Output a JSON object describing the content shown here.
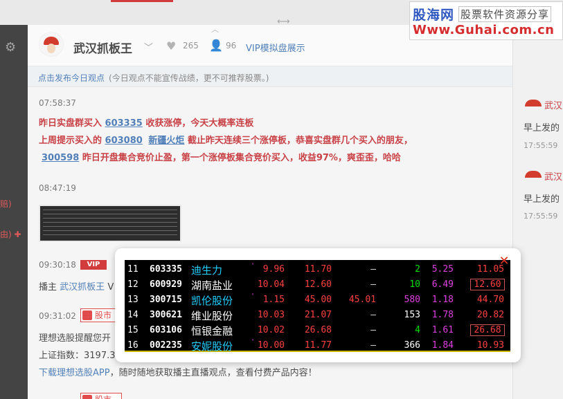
{
  "header": {
    "host_name": "武汉抓板王",
    "likes": "265",
    "fans": "96",
    "vip_link": "VIP模拟盘展示"
  },
  "notice": {
    "link": "点击发布今日观点",
    "hint": "(今日观点不能宣传战绩，更不可推荐股票。)"
  },
  "feed": {
    "post1": {
      "time": "07:58:37",
      "l1_a": "昨日实盘群买入",
      "l1_code": "603335",
      "l1_b": "收获涨停，今天大概率连板",
      "l2_a": "上周提示买入的",
      "l2_code": "603080",
      "l2_sector": "新疆火炬",
      "l2_b": "截止昨天连续三个涨停板，恭喜实盘群几个买入的朋友，",
      "l3_code": "300598",
      "l3_b": "昨日开盘集合竞价止盈，第一个涨停板集合竞价买入，收益97%，爽歪歪，哈哈"
    },
    "post2_time": "08:47:19",
    "post3": {
      "time": "09:30:18",
      "vip": "VIP",
      "prefix": "播主",
      "host": "武汉抓板王",
      "suffix": "V"
    },
    "post4": {
      "time": "09:31:02",
      "tag": "股市",
      "line1": "理想选股提醒您开",
      "line2": "上证指数：3197.3"
    },
    "download": {
      "link": "下载理想选股APP",
      "rest": "，随时随地获取播主直播观点，查看付费产品内容！"
    },
    "post5_tag": "股市"
  },
  "left_tabs": {
    "a": "赔)",
    "b": "由) ✚"
  },
  "right_column": [
    {
      "name": "武汉",
      "text": "早上发的",
      "time": "17:55:59"
    },
    {
      "name": "武汉",
      "text": "早上发的",
      "time": "17:55:59"
    }
  ],
  "watermark": {
    "cn": "股海网",
    "tagline": "股票软件资源分享",
    "url": "Www.Guhai.com.cn"
  },
  "modal": {
    "close": "✕",
    "rows": [
      {
        "idx": "11",
        "code": "603335",
        "name": "迪生力",
        "dot": "'",
        "pct": "9.96",
        "price": "11.70",
        "extra": "—",
        "vol": "2",
        "ratio": "5.25",
        "last": "11.05",
        "name_color": "#22d0ff",
        "pct_color": "#ff4040",
        "price_color": "#ff4040",
        "extra_color": "#dddddd",
        "vol_color": "#00e000",
        "last_color": "#ff4040",
        "last_boxed": false
      },
      {
        "idx": "12",
        "code": "600929",
        "name": "湖南盐业",
        "dot": "",
        "pct": "10.04",
        "price": "12.60",
        "extra": "—",
        "vol": "10",
        "ratio": "6.49",
        "last": "12.60",
        "name_color": "#ffffff",
        "pct_color": "#ff4040",
        "price_color": "#ff4040",
        "extra_color": "#dddddd",
        "vol_color": "#00e000",
        "last_color": "#ff4040",
        "last_boxed": true
      },
      {
        "idx": "13",
        "code": "300715",
        "name": "凯伦股份",
        "dot": "'",
        "pct": "1.15",
        "price": "45.00",
        "extra": "45.01",
        "vol": "580",
        "ratio": "1.18",
        "last": "44.70",
        "name_color": "#22d0ff",
        "pct_color": "#ff4040",
        "price_color": "#ff4040",
        "extra_color": "#ff4040",
        "vol_color": "#e040e0",
        "last_color": "#ff4040",
        "last_boxed": false
      },
      {
        "idx": "14",
        "code": "300621",
        "name": "维业股份",
        "dot": "",
        "pct": "10.03",
        "price": "21.07",
        "extra": "—",
        "vol": "153",
        "ratio": "1.78",
        "last": "20.82",
        "name_color": "#ffffff",
        "pct_color": "#ff4040",
        "price_color": "#ff4040",
        "extra_color": "#dddddd",
        "vol_color": "#ffffff",
        "last_color": "#ff4040",
        "last_boxed": false
      },
      {
        "idx": "15",
        "code": "603106",
        "name": "恒银金融",
        "dot": "",
        "pct": "10.02",
        "price": "26.68",
        "extra": "—",
        "vol": "4",
        "ratio": "1.61",
        "last": "26.68",
        "name_color": "#ffffff",
        "pct_color": "#ff4040",
        "price_color": "#ff4040",
        "extra_color": "#dddddd",
        "vol_color": "#00e000",
        "last_color": "#ff4040",
        "last_boxed": true
      },
      {
        "idx": "16",
        "code": "002235",
        "name": "安妮股份",
        "dot": "'",
        "pct": "10.00",
        "price": "11.77",
        "extra": "—",
        "vol": "366",
        "ratio": "1.84",
        "last": "10.93",
        "name_color": "#22d0ff",
        "pct_color": "#ff4040",
        "price_color": "#ff4040",
        "extra_color": "#dddddd",
        "vol_color": "#ffffff",
        "last_color": "#ff4040",
        "last_boxed": false
      }
    ]
  }
}
